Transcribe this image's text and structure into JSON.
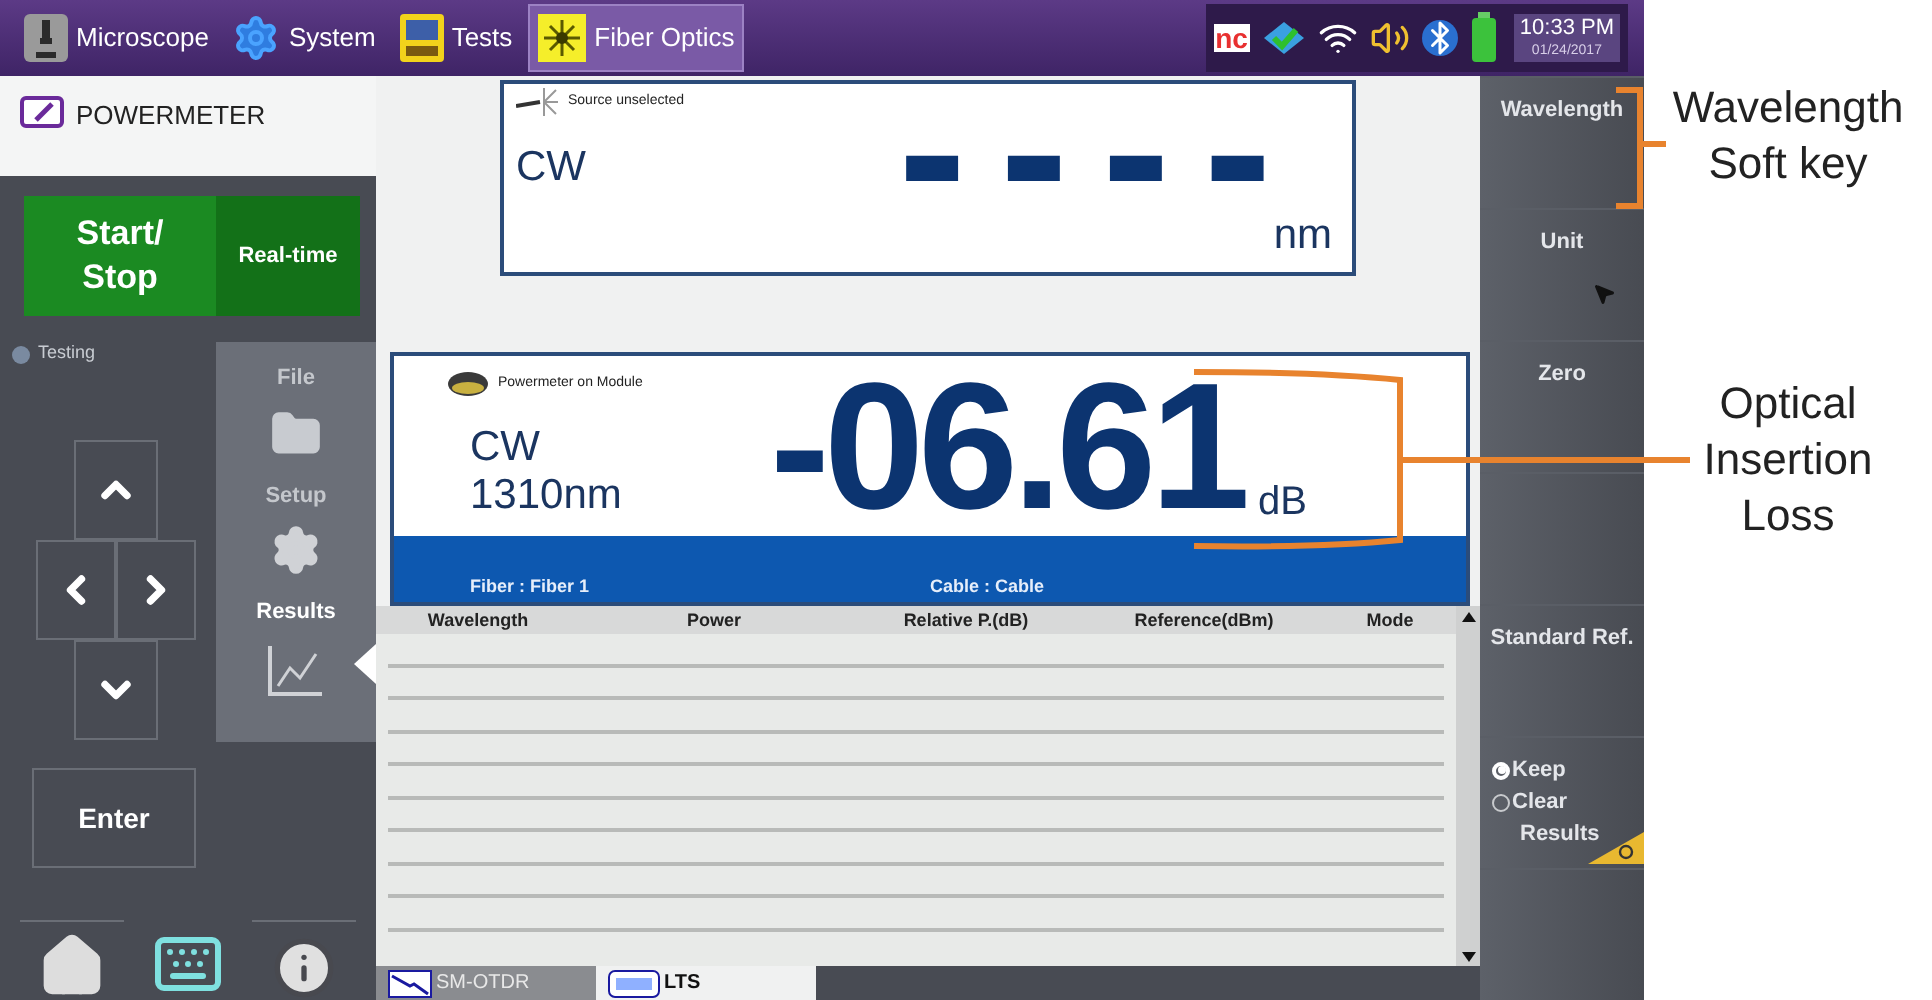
{
  "top_bar": {
    "tabs": [
      {
        "label": "Microscope",
        "kind": "microscope",
        "selected": false
      },
      {
        "label": "System",
        "kind": "system",
        "selected": false
      },
      {
        "label": "Tests",
        "kind": "tests",
        "selected": false
      },
      {
        "label": "Fiber Optics",
        "kind": "fiber",
        "selected": true
      }
    ],
    "logo": "nc",
    "time": "10:33 PM",
    "date": "01/24/2017"
  },
  "app_title": "POWERMETER",
  "start_stop": [
    "Start/",
    "Stop"
  ],
  "realtime": "Real-time",
  "status_indicator": {
    "label": "Testing",
    "on": false
  },
  "side_menu": [
    {
      "label": "File",
      "kind": "file",
      "selected": false
    },
    {
      "label": "Setup",
      "kind": "setup",
      "selected": false
    },
    {
      "label": "Results",
      "kind": "results",
      "selected": true
    }
  ],
  "enter": "Enter",
  "source": {
    "caption": "Source unselected",
    "mode": "CW",
    "value": "▬ ▬ ▬ ▬",
    "unit": "nm"
  },
  "meter": {
    "caption": "Powermeter on Module",
    "mode": "CW",
    "wavelength": "1310nm",
    "value": "-06.61",
    "unit": "dB",
    "fiber": "Fiber : Fiber  1",
    "cable": "Cable : Cable"
  },
  "table": {
    "columns": [
      "Wavelength",
      "Power",
      "Relative P.(dB)",
      "Reference(dBm)",
      "Mode"
    ]
  },
  "bottom_tabs": [
    {
      "label": "SM-OTDR",
      "kind": "otdr",
      "selected": false
    },
    {
      "label": "LTS",
      "kind": "lts",
      "selected": true
    }
  ],
  "soft_keys": [
    {
      "kind": "label",
      "label": "Wavelength"
    },
    {
      "kind": "label",
      "label": "Unit",
      "pointer": true
    },
    {
      "kind": "label",
      "label": "Zero"
    },
    {
      "kind": "blank"
    },
    {
      "kind": "label",
      "label": "Standard Ref."
    },
    {
      "kind": "radio",
      "options": [
        {
          "label": "Keep",
          "selected": true
        },
        {
          "label": "Clear",
          "selected": false
        }
      ],
      "label": "Results"
    },
    {
      "kind": "blank"
    }
  ],
  "annotations": [
    {
      "label": "Wavelength Soft key"
    },
    {
      "label": "Optical Insertion Loss"
    }
  ]
}
